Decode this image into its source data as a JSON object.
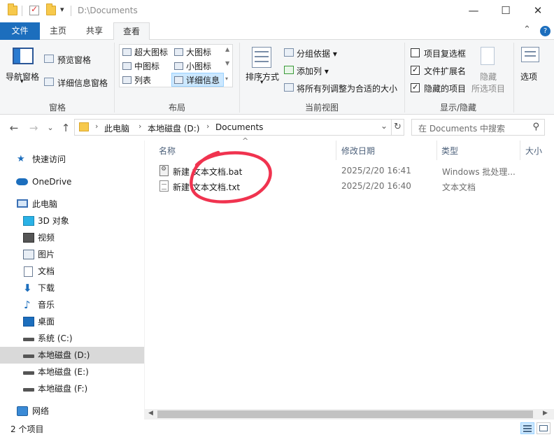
{
  "window": {
    "title": "D:\\Documents",
    "minimize_glyph": "—",
    "maximize_glyph": "☐",
    "close_glyph": "✕",
    "quick_access_dropdown": "▾"
  },
  "tabs": {
    "file": "文件",
    "home": "主页",
    "share": "共享",
    "view": "查看",
    "collapse_glyph": "⌃",
    "help_glyph": "?"
  },
  "ribbon": {
    "panes": {
      "nav_pane": "导航窗格",
      "preview_pane": "预览窗格",
      "details_pane": "详细信息窗格",
      "label": "窗格"
    },
    "layout": {
      "extra_large": "超大图标",
      "large": "大图标",
      "medium": "中图标",
      "small": "小图标",
      "list": "列表",
      "details": "详细信息",
      "label": "布局"
    },
    "current_view": {
      "sort_by": "排序方式",
      "group_by": "分组依据",
      "add_column": "添加列",
      "size_all_columns": "将所有列调整为合适的大小",
      "label": "当前视图"
    },
    "show_hide": {
      "item_checkboxes": "项目复选框",
      "item_checkboxes_checked": false,
      "file_extensions": "文件扩展名",
      "file_extensions_checked": true,
      "hidden_items": "隐藏的项目",
      "hidden_items_checked": true,
      "hide_selected": "隐藏",
      "hide_selected_sub": "所选项目",
      "label": "显示/隐藏"
    },
    "options": "选项"
  },
  "address": {
    "crumbs": [
      "此电脑",
      "本地磁盘 (D:)",
      "Documents"
    ],
    "back_glyph": "←",
    "forward_glyph": "→",
    "recent_glyph": "⌄",
    "up_glyph": "↑",
    "refresh_glyph": "↻",
    "dropdown_glyph": "⌄"
  },
  "search": {
    "placeholder": "在 Documents 中搜索",
    "icon_glyph": "⚲"
  },
  "sidebar": {
    "items": [
      {
        "label": "快速访问",
        "icon": "star-icon"
      },
      {
        "label": "OneDrive",
        "icon": "cloud-icon"
      },
      {
        "label": "此电脑",
        "icon": "computer-icon"
      },
      {
        "label": "3D 对象",
        "icon": "cube-icon"
      },
      {
        "label": "视频",
        "icon": "video-icon"
      },
      {
        "label": "图片",
        "icon": "picture-icon"
      },
      {
        "label": "文档",
        "icon": "document-icon"
      },
      {
        "label": "下载",
        "icon": "download-icon"
      },
      {
        "label": "音乐",
        "icon": "music-icon"
      },
      {
        "label": "桌面",
        "icon": "desktop-icon"
      },
      {
        "label": "系统 (C:)",
        "icon": "drive-icon"
      },
      {
        "label": "本地磁盘 (D:)",
        "icon": "drive-icon",
        "selected": true
      },
      {
        "label": "本地磁盘 (E:)",
        "icon": "drive-icon"
      },
      {
        "label": "本地磁盘 (F:)",
        "icon": "drive-icon"
      },
      {
        "label": "网络",
        "icon": "network-icon"
      }
    ]
  },
  "columns": {
    "name": "名称",
    "modified": "修改日期",
    "type": "类型",
    "size": "大小",
    "sort_glyph": "^"
  },
  "files": [
    {
      "name": "新建 文本文档.bat",
      "modified": "2025/2/20 16:41",
      "type": "Windows 批处理...",
      "icon": "batch-file-icon"
    },
    {
      "name": "新建 文本文档.txt",
      "modified": "2025/2/20 16:40",
      "type": "文本文档",
      "icon": "text-file-icon"
    }
  ],
  "status": {
    "item_count": "2 个项目"
  },
  "colors": {
    "file_tab": "#1c6ebd",
    "selected_row": "#d9d9d9",
    "annotation": "#f0334f"
  }
}
